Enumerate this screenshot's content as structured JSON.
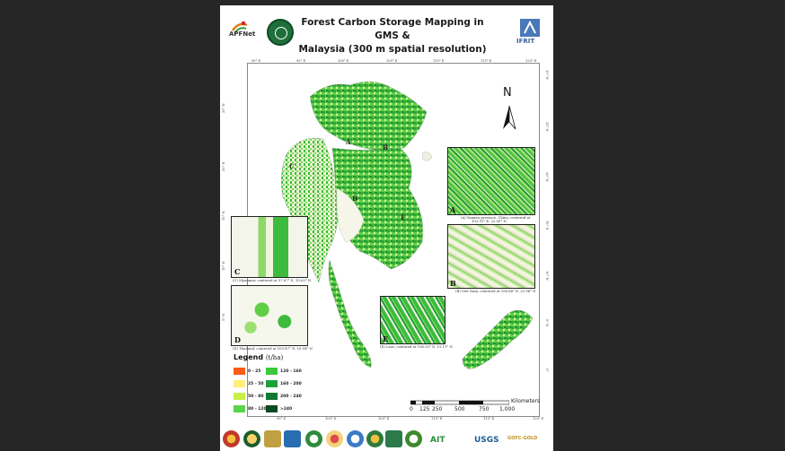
{
  "title_line1": "Forest Carbon Storage Mapping in GMS &",
  "title_line2": "Malaysia (300 m spatial resolution)",
  "logos": {
    "apfnet": "APFNet",
    "ifrit": "IFRIT",
    "ait": "AIT",
    "usgs": "USGS",
    "gofc": "GOFC-GOLD"
  },
  "graticule": {
    "top": [
      "90° E",
      "95° E",
      "100° E",
      "105° E",
      "110° E",
      "115° E",
      "120° E"
    ],
    "bottom": [
      "90° E",
      "95° E",
      "100° E",
      "105° E",
      "110° E",
      "115° E",
      "120° E"
    ],
    "left": [
      "30° N",
      "25° N",
      "20° N",
      "15° N",
      "10° N",
      "5° N"
    ],
    "right": [
      "30° N",
      "25° N",
      "20° N",
      "15° N",
      "10° N",
      "5° N",
      "0°"
    ]
  },
  "north": "N",
  "map_labels": {
    "a": "A",
    "b": "B",
    "c": "C",
    "d": "D",
    "e": "E"
  },
  "insets": {
    "a": {
      "letter": "A",
      "caption_1": "(A) Yunnan province, China, centered at",
      "caption_2": "102.91° E, 22.50° N"
    },
    "b": {
      "letter": "B",
      "caption": "(B) Viet Nam, centered at 106.66° E, 22.96° N"
    },
    "c": {
      "letter": "C",
      "caption": "(C) Myanmar, centered at 97.67° E, 19.62° N"
    },
    "d": {
      "letter": "D",
      "caption": "(D) Thailand, centered at 103.87° N, 16.94° N"
    },
    "e": {
      "letter": "E",
      "caption": "(E) Laos, centered at 106.20° N, 15.11° N"
    }
  },
  "legend": {
    "title": "Legend",
    "unit": "(t/ha)",
    "classes": [
      {
        "label": "0 - 25",
        "color": "#ff5a1a"
      },
      {
        "label": "25 - 50",
        "color": "#fff07a"
      },
      {
        "label": "50 - 80",
        "color": "#c8f04a"
      },
      {
        "label": "80 - 120",
        "color": "#5ad44a"
      },
      {
        "label": "120 - 160",
        "color": "#3cc83c"
      },
      {
        "label": "160 - 200",
        "color": "#1ea03c"
      },
      {
        "label": "200 - 240",
        "color": "#0f7a32"
      },
      {
        "label": ">240",
        "color": "#0a4a28"
      }
    ]
  },
  "scale_bar": {
    "unit": "Kilometers",
    "labels": [
      "0",
      "125",
      "250",
      "500",
      "750",
      "1,000"
    ]
  }
}
